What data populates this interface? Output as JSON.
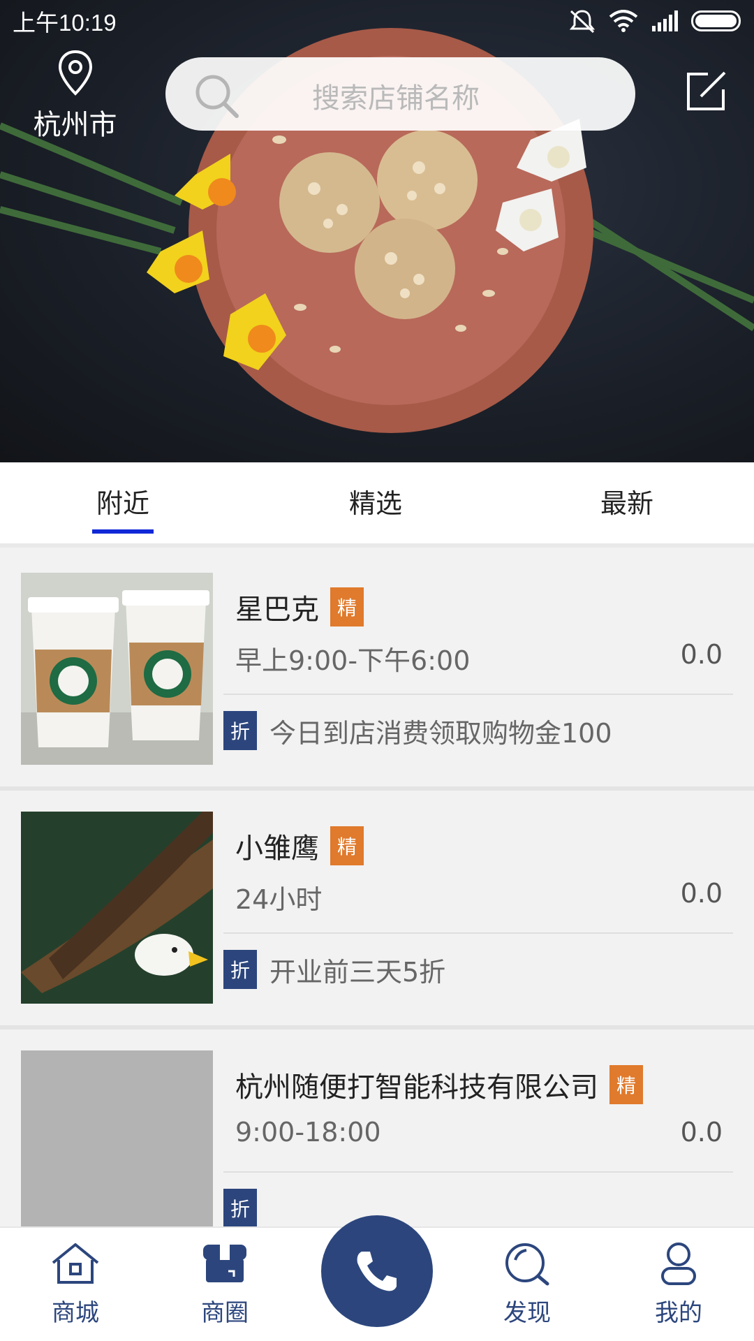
{
  "status_bar": {
    "time": "上午10:19"
  },
  "header": {
    "city": "杭州市",
    "search_placeholder": "搜索店铺名称"
  },
  "tabs": [
    {
      "label": "附近",
      "active": true
    },
    {
      "label": "精选",
      "active": false
    },
    {
      "label": "最新",
      "active": false
    }
  ],
  "stores": [
    {
      "name": "星巴克",
      "badge": "精",
      "hours": "早上9:00-下午6:00",
      "rating": "0.0",
      "promo_badge": "折",
      "promo": "今日到店消费领取购物金100"
    },
    {
      "name": "小雏鹰",
      "badge": "精",
      "hours": "24小时",
      "rating": "0.0",
      "promo_badge": "折",
      "promo": "开业前三天5折"
    },
    {
      "name": "杭州随便打智能科技有限公司",
      "badge": "精",
      "hours": "9:00-18:00",
      "rating": "0.0",
      "promo_badge": "折",
      "promo": ""
    }
  ],
  "bottom_nav": [
    {
      "label": "商城",
      "icon": "home-icon"
    },
    {
      "label": "商圈",
      "icon": "shop-icon"
    },
    {
      "label": "",
      "icon": "phone-icon"
    },
    {
      "label": "发现",
      "icon": "discover-icon"
    },
    {
      "label": "我的",
      "icon": "profile-icon"
    }
  ],
  "colors": {
    "primary": "#2c467d",
    "tab_indicator": "#1028d8",
    "badge_jing": "#e07a2c"
  }
}
